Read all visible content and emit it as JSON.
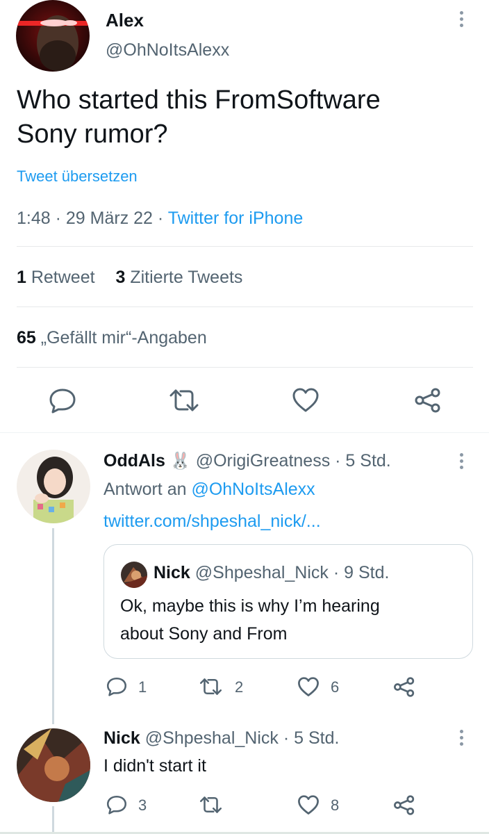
{
  "main_tweet": {
    "author_name": "Alex",
    "author_handle": "@OhNoItsAlexx",
    "text_line1": "Who started this FromSoftware",
    "text_line2": "Sony rumor?",
    "translate_label": "Tweet übersetzen",
    "time": "1:48",
    "sep1": " · ",
    "date": "29 März 22",
    "sep2": " · ",
    "client": "Twitter for iPhone",
    "retweet_count": "1",
    "retweet_label": " Retweet",
    "quote_count": "3",
    "quote_label": " Zitierte Tweets",
    "like_count": "65",
    "like_label": " „Gefällt mir“-Angaben"
  },
  "action_bar": {
    "icons": [
      "reply-icon",
      "retweet-icon",
      "like-icon",
      "share-icon"
    ]
  },
  "replies": [
    {
      "author_name": "OddAls",
      "emoji": "🐰",
      "author_handle": "@OrigiGreatness",
      "age": "· 5 Std.",
      "reply_to_prefix": "Antwort an ",
      "reply_to_handle": "@OhNoItsAlexx",
      "link_text": "twitter.com/shpeshal_nick/...",
      "quote": {
        "author_name": "Nick",
        "author_handle": "@Shpeshal_Nick",
        "age": "· 9 Std.",
        "text_line1": "Ok, maybe this is why I’m hearing",
        "text_line2": "about Sony and From"
      },
      "reply_count": "1",
      "retweet_count": "2",
      "like_count": "6"
    },
    {
      "author_name": "Nick",
      "author_handle": "@Shpeshal_Nick",
      "age": "· 5 Std.",
      "text": "I didn't start it",
      "reply_count": "3",
      "retweet_count": "",
      "like_count": "8"
    }
  ],
  "colors": {
    "accent": "#1d9bf0",
    "text": "#0f1419",
    "muted": "#536471",
    "divider": "#e7e9ea"
  }
}
